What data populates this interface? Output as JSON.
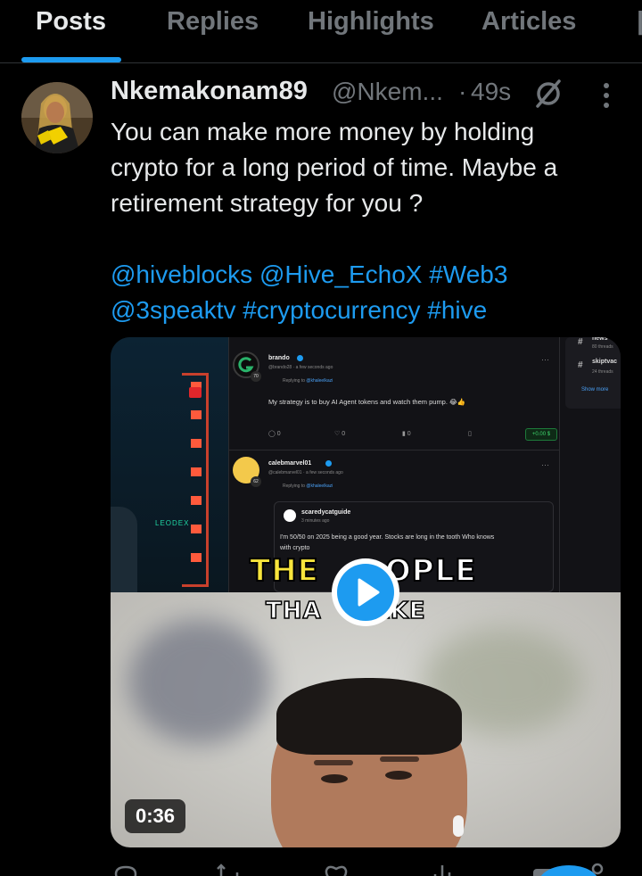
{
  "tabs": [
    {
      "label": "Posts",
      "active": true
    },
    {
      "label": "Replies",
      "active": false
    },
    {
      "label": "Highlights",
      "active": false
    },
    {
      "label": "Articles",
      "active": false
    }
  ],
  "colors": {
    "accent": "#1d9bf0",
    "text": "#e7e9ea",
    "muted": "#71767b",
    "background": "#000000"
  },
  "post": {
    "display_name": "Nkemakonam89",
    "handle": "@Nkem...",
    "separator": "·",
    "time": "49s",
    "text_lines": [
      "You can make more money by holding",
      "crypto for a long period of time.  Maybe a",
      "retirement strategy for you ?"
    ],
    "tags_line1": [
      "@hiveblocks",
      "@Hive_EchoX",
      "#Web3"
    ],
    "tags_line2": [
      "@3speaktv",
      "#cryptocurrency",
      "#hive"
    ],
    "icons": {
      "status": "hidden-slash-icon",
      "more": "more-vertical-icon"
    },
    "media": {
      "type": "video",
      "duration": "0:36",
      "overlay_line1": {
        "part1": "THE",
        "part2": "OPLE"
      },
      "overlay_line2": {
        "part1": "THA",
        "part2": "AKE"
      },
      "embedded_feed": {
        "side": {
          "item1": "news",
          "item2": "skiptvac",
          "hash": "#",
          "show_more": "Show more",
          "sub1": "80 threads",
          "sub2": "24 threads"
        },
        "post1": {
          "name": "brando",
          "meta": "@brando28 · a few seconds ago",
          "reply_prefix": "Replying to",
          "reply_to": "@khaleelkazi",
          "body": "My strategy is to buy AI Agent tokens and watch them pump. 😂👍",
          "counts": [
            "0",
            "0",
            "0"
          ],
          "value": "+0.00 $",
          "badge": "70"
        },
        "post2": {
          "name": "calebmarvel01",
          "meta": "@calebmarvel01 · a few seconds ago",
          "reply_prefix": "Replying to",
          "reply_to": "@khaleelkazi",
          "badge": "62",
          "quote_name": "scaredycatguide",
          "quote_meta": "3 minutes ago",
          "quote_body1": "I'm 50/50 on 2025 being a good year. Stocks are long in the tooth Who knows",
          "quote_body2": "with crypto"
        },
        "brand": "LEODEX"
      }
    }
  }
}
